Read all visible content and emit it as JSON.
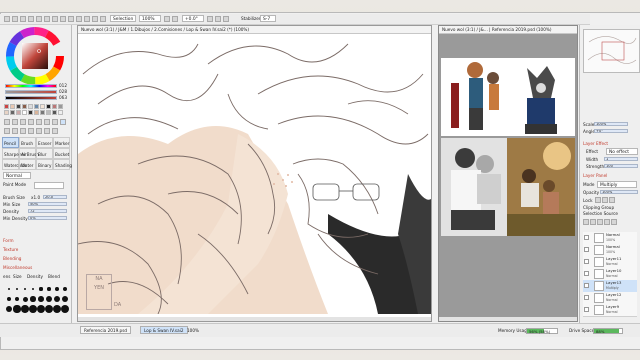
{
  "toolbar": {
    "selection_label": "Selection",
    "zoom": "100%",
    "rotation": "+0.0°",
    "stabilizer_label": "Stabilizer",
    "stabilizer_value": "S-7"
  },
  "navigator": {
    "zoom": "100%",
    "angle": "+0.0°"
  },
  "color_sliders": [
    {
      "label": "H",
      "value": "012"
    },
    {
      "label": "S",
      "value": "028"
    },
    {
      "label": "V",
      "value": "063"
    }
  ],
  "tool_names": [
    "Pencil",
    "Brush",
    "Eraser",
    "Marker",
    "Sharpener",
    "AirBrush",
    "Blur",
    "Bucket",
    "Watercolor",
    "Water",
    "Binary",
    "Shading"
  ],
  "brush": {
    "blend_label": "Normal",
    "paint_mode_label": "Paint Mode",
    "size_label": "Brush Size",
    "size_mult": "x1.0",
    "size_value": "20.0",
    "min_size_label": "Min Size",
    "min_size_value": "50%",
    "density_label": "Density",
    "density_value": "72",
    "min_density_label": "Min Density",
    "min_density_value": "0%",
    "form_label": "Form",
    "texture_label": "Texture",
    "blending_label": "Blending",
    "misc_label": "Miscellaneous",
    "pressure_label": "Size",
    "pressure_density": "Density",
    "pressure_blend": "Blend",
    "pressure_prefix": "ens",
    "dot_sizes": [
      "1",
      "2",
      "3",
      "4",
      "5",
      "6",
      "7",
      "8",
      "9",
      "10",
      "12",
      "14",
      "16",
      "20",
      "25",
      "30",
      "35",
      "40",
      "45",
      "50",
      "60",
      "70",
      "80",
      "100"
    ]
  },
  "canvas": {
    "title": "Nuevo wol (3:1) / J&M / 1.Dibujos / 2.Comisiones / Lop & Swan IV.sai2 (*) (100%)"
  },
  "reference": {
    "title": "Nuevo wol (3:1) / J&... | Referencia 2019.psd (100%)"
  },
  "layer_panel": {
    "scale_label": "Scale",
    "scale_value": "100%",
    "angle_label": "Angle",
    "angle_value": "+0°",
    "effect_section": "Layer Effect",
    "effect_label": "Effect",
    "effect_value": "No effect",
    "width_label": "Width",
    "width_value": "1",
    "strength_label": "Strength",
    "strength_value": "100",
    "panel_section": "Layer Panel",
    "mode_label": "Mode",
    "mode_value": "Multiply",
    "opacity_label": "Opacity",
    "opacity_value": "100%",
    "lock_label": "Lock",
    "clipping_label": "Clipping Group",
    "selection_source_label": "Selection Source",
    "layers": [
      {
        "name": "Normal",
        "mode": "100%"
      },
      {
        "name": "Normal",
        "mode": "100%"
      },
      {
        "name": "Layer11",
        "mode": "Normal"
      },
      {
        "name": "Layer10",
        "mode": "Normal"
      },
      {
        "name": "Layer13",
        "mode": "Multiply"
      },
      {
        "name": "Layer12",
        "mode": "Normal"
      },
      {
        "name": "Layer9",
        "mode": "Normal"
      }
    ]
  },
  "statusbar": {
    "tab1": "Referencia 2019.psd",
    "tab2": "Lop & Swan IV.sai2",
    "tab2_zoom": "100%",
    "memory_label": "Memory Usage",
    "memory_value": "56% (58%)",
    "memory_fraction": 0.56,
    "drive_label": "Drive Space",
    "drive_value": "88%",
    "drive_fraction": 0.88
  },
  "watermark": {
    "line1": "NA",
    "line2": "YEN",
    "line3": "DA"
  },
  "colors": {
    "accent_selected": "#cfe2f8",
    "section_red": "#c0392b",
    "canvas_skin": "#f1dccb",
    "meter_green": "#5bb85d"
  }
}
